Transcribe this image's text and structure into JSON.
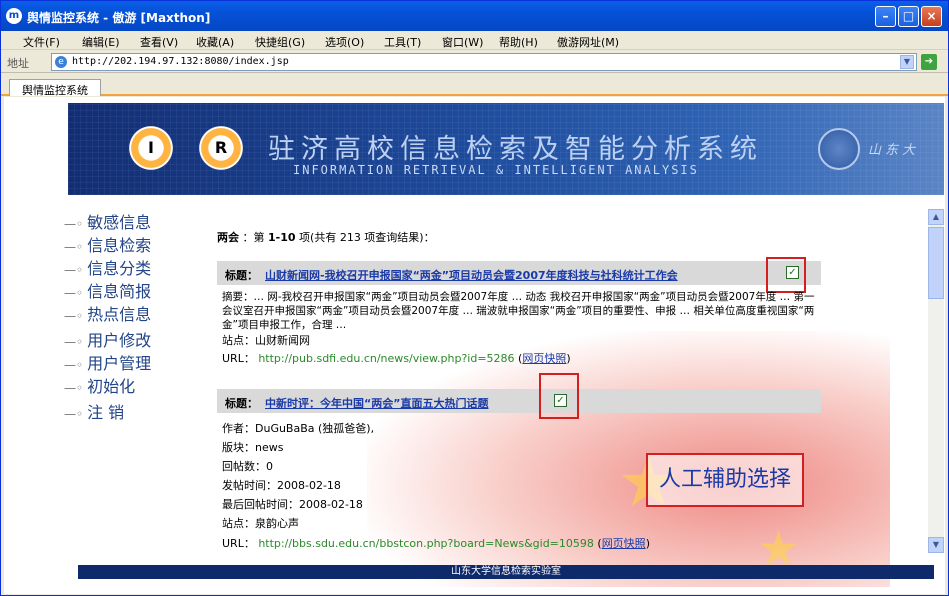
{
  "window": {
    "title": "舆情监控系统 - 傲游 [Maxthon]",
    "app_icon": "maxthon-icon"
  },
  "menu": [
    "文件(F)",
    "编辑(E)",
    "查看(V)",
    "收藏(A)",
    "快捷组(G)",
    "选项(O)",
    "工具(T)",
    "窗口(W)",
    "帮助(H)",
    "傲游网址(M)"
  ],
  "address": {
    "label": "地址",
    "url": "http://202.194.97.132:8080/index.jsp"
  },
  "tab": {
    "label": "舆情监控系统"
  },
  "banner": {
    "logo_left": "I",
    "logo_right": "R",
    "title": "驻济高校信息检索及智能分析系统",
    "subtitle": "INFORMATION RETRIEVAL & INTELLIGENT ANALYSIS",
    "script": "山东大"
  },
  "sidebar": [
    "敏感信息",
    "信息检索",
    "信息分类",
    "信息简报",
    "热点信息",
    "用户修改",
    "用户管理",
    "初始化",
    "注 销"
  ],
  "query": {
    "keyword": "两会",
    "sep": "：第",
    "range": "1-10",
    "rest": "项(共有 213 项查询结果)："
  },
  "results": [
    {
      "title_label": "标题：",
      "title": "山财新闻网-我校召开申报国家“两金”项目动员会暨2007年度科技与社科统计工作会",
      "abstract_label": "摘要：",
      "abstract": "… 网-我校召开申报国家“两金”项目动员会暨2007年度 … 动态 我校召开申报国家“两金”项目动员会暨2007年度 … 第一会议室召开申报国家“两金”项目动员会暨2007年度 … 瑞波就申报国家“两金”项目的重要性、申报 … 相关单位高度重视国家“两金”项目申报工作，合理 …",
      "site": "站点：山财新闻网",
      "url_label": "URL：",
      "url": "http://pub.sdfi.edu.cn/news/view.php?id=5286",
      "snapshot": "网页快照"
    },
    {
      "title_label": "标题：",
      "title": "中新时评：今年中国“两会”直面五大热门话题",
      "author": "作者：DuGuBaBa (独孤爸爸),",
      "board": "版块：news",
      "replies": "回帖数：0",
      "posted": "发帖时间：2008-02-18",
      "last_reply": "最后回帖时间：2008-02-18",
      "site": "站点：泉韵心声",
      "url_label": "URL：",
      "url": "http://bbs.sdu.edu.cn/bbstcon.php?board=News&gid=10598",
      "snapshot": "网页快照"
    }
  ],
  "annotation": "人工辅助选择",
  "footer": "山东大学信息检索实验室",
  "colors": {
    "accent_red": "#d21f1f",
    "link_blue": "#1a3aa8",
    "url_green": "#2a8a2a",
    "banner_blue": "#1d4a9c"
  }
}
